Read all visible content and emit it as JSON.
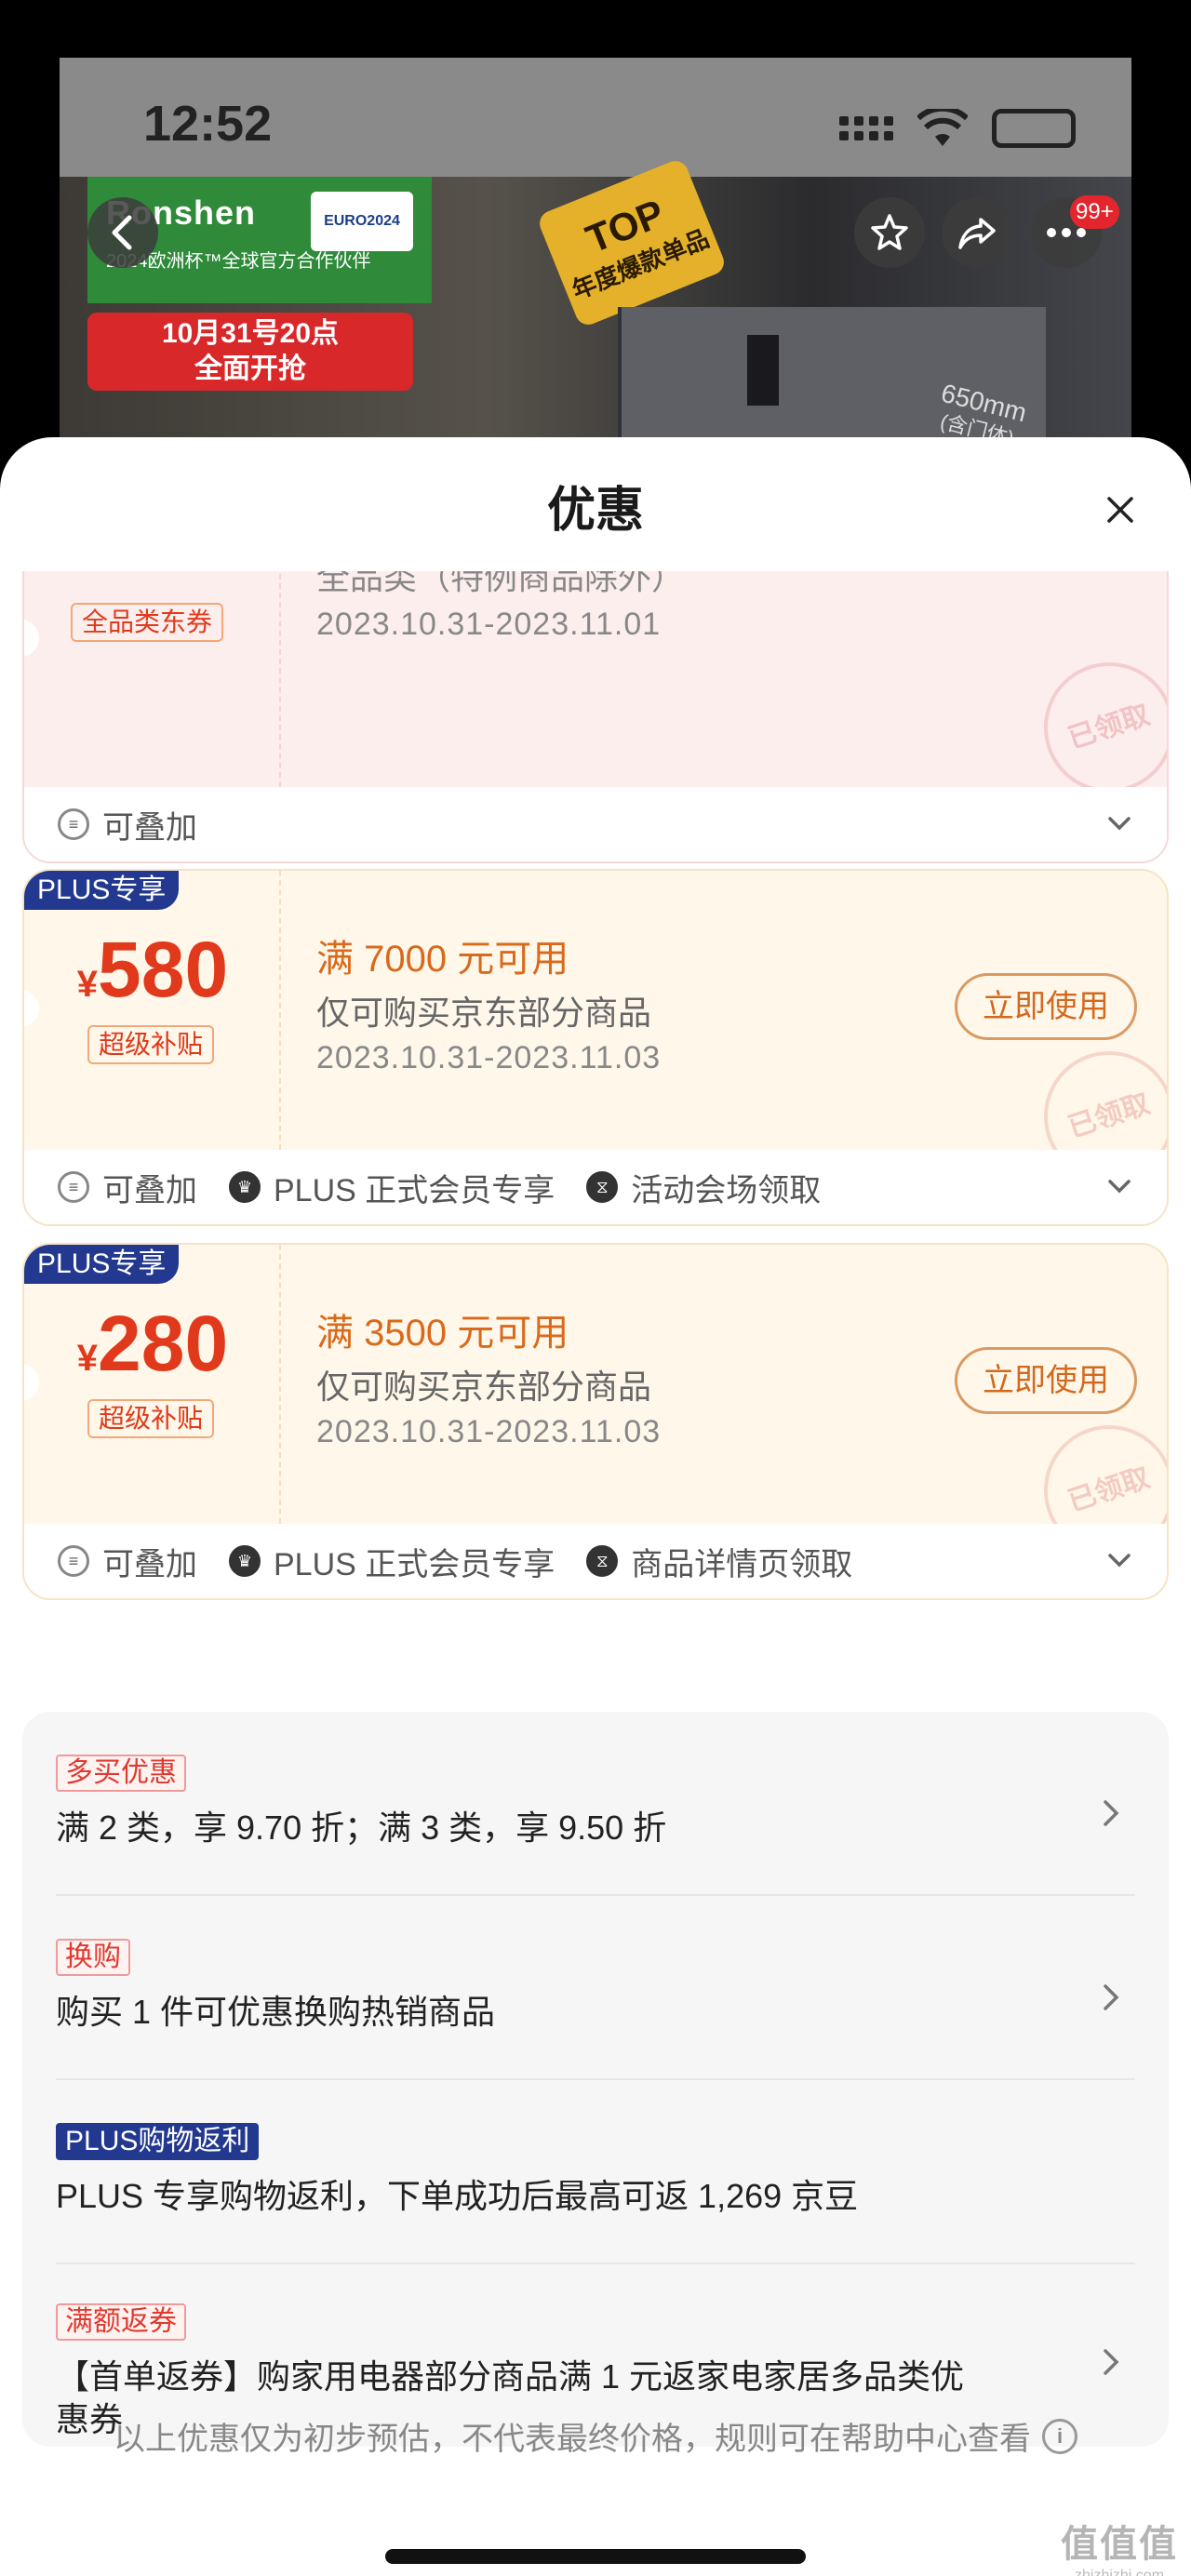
{
  "status_bar": {
    "time": "12:52"
  },
  "hero": {
    "brand_name": "Ronshen",
    "brand_sub": "2024欧洲杯™全球官方合作伙伴",
    "euro_badge": "EURO2024",
    "sale_banner_line1": "10月31号20点",
    "sale_banner_line2": "全面开抢",
    "top_badge_big": "TOP",
    "top_badge_small": "年度爆款单品",
    "fridge_size": "650mm",
    "fridge_size_note": "(含门体)",
    "message_count": "99+"
  },
  "sheet": {
    "title": "优惠",
    "coupons": [
      {
        "amount_partial": "¥",
        "tag": "全品类东券",
        "scope": "全品类（特例商品除外）",
        "dates": "2023.10.31-2023.11.01",
        "stamp": "已领取",
        "footer": [
          "可叠加"
        ]
      },
      {
        "plus_tag": "PLUS专享",
        "currency": "¥",
        "amount": "580",
        "tag": "超级补贴",
        "condition": "满 7000 元可用",
        "scope": "仅可购买京东部分商品",
        "dates": "2023.10.31-2023.11.03",
        "button": "立即使用",
        "stamp": "已领取",
        "footer": [
          "可叠加",
          "PLUS 正式会员专享",
          "活动会场领取"
        ]
      },
      {
        "plus_tag": "PLUS专享",
        "currency": "¥",
        "amount": "280",
        "tag": "超级补贴",
        "condition": "满 3500 元可用",
        "scope": "仅可购买京东部分商品",
        "dates": "2023.10.31-2023.11.03",
        "button": "立即使用",
        "stamp": "已领取",
        "footer": [
          "可叠加",
          "PLUS 正式会员专享",
          "商品详情页领取"
        ]
      }
    ],
    "promotions": [
      {
        "tag": "多买优惠",
        "text": "满 2 类，享 9.70 折；满 3 类，享 9.50 折"
      },
      {
        "tag": "换购",
        "text": "购买 1 件可优惠换购热销商品"
      },
      {
        "tag": "PLUS购物返利",
        "text": "PLUS 专享购物返利，下单成功后最高可返 1,269 京豆"
      },
      {
        "tag": "满额返券",
        "text": "【首单返券】购家用电器部分商品满 1 元返家电家居多品类优惠券"
      }
    ],
    "disclaimer": "以上优惠仅为初步预估，不代表最终价格，规则可在帮助中心查看"
  },
  "watermark": {
    "big": "值值值",
    "small": "zhizhizhi.com"
  },
  "colors": {
    "accent": "#e0391b",
    "plus_blue": "#23388f",
    "coupon_bg": "#fff8ea"
  }
}
